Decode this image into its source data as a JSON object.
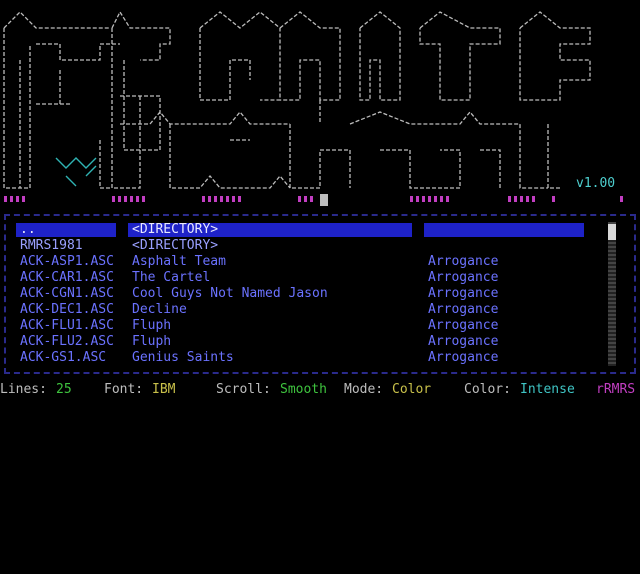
{
  "logo": {
    "version": "v1.00"
  },
  "files": [
    {
      "file": "..",
      "title": "<DIRECTORY>",
      "group": "",
      "selected": true
    },
    {
      "file": "RMRS1981",
      "title": "<DIRECTORY>",
      "group": ""
    },
    {
      "file": "ACK-ASP1.ASC",
      "title": "Asphalt Team",
      "group": "Arrogance"
    },
    {
      "file": "ACK-CAR1.ASC",
      "title": "The Cartel",
      "group": "Arrogance"
    },
    {
      "file": "ACK-CGN1.ASC",
      "title": "Cool Guys Not Named Jason",
      "group": "Arrogance"
    },
    {
      "file": "ACK-DEC1.ASC",
      "title": "Decline",
      "group": "Arrogance"
    },
    {
      "file": "ACK-FLU1.ASC",
      "title": "Fluph",
      "group": "Arrogance"
    },
    {
      "file": "ACK-FLU2.ASC",
      "title": "Fluph",
      "group": "Arrogance"
    },
    {
      "file": "ACK-GS1.ASC",
      "title": "Genius Saints",
      "group": "Arrogance"
    }
  ],
  "status": {
    "lines_label": "Lines:",
    "lines_value": "25",
    "font_label": "Font:",
    "font_value": "IBM",
    "scroll_label": "Scroll:",
    "scroll_value": "Smooth",
    "mode_label": "Mode:",
    "mode_value": "Color",
    "color_label": "Color:",
    "color_value": "Intense",
    "brand": "rRMRS"
  },
  "colors": {
    "highlight": "#1e22c8",
    "list_text": "#6b72ff",
    "accent_magenta": "#c23ec2",
    "accent_cyan": "#4ecfcf"
  }
}
